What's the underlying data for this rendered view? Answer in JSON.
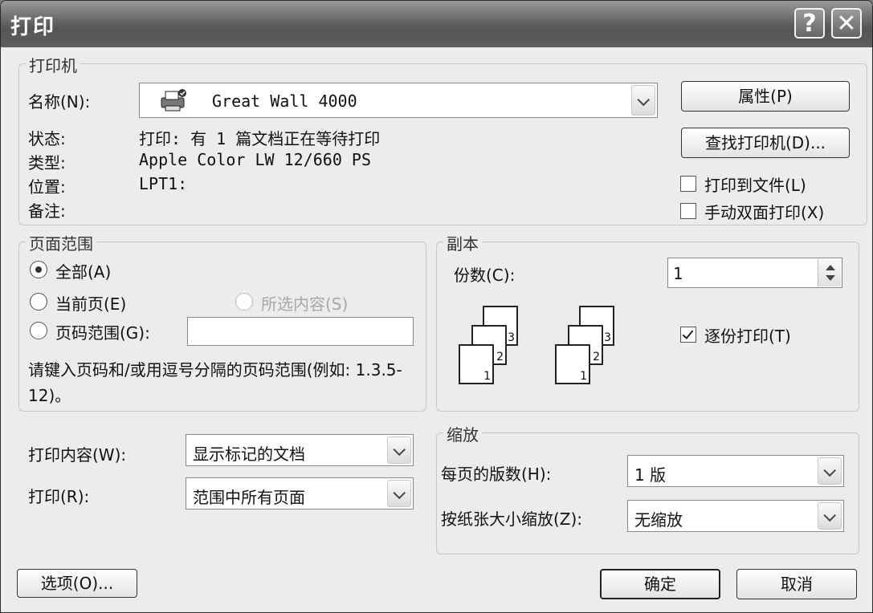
{
  "window": {
    "title": "打印",
    "help_glyph": "?",
    "close_glyph": "✕"
  },
  "printer": {
    "legend": "打印机",
    "name_label": "名称(N):",
    "name_value": "Great Wall 4000",
    "status_label": "状态:",
    "status_value": "打印: 有 1 篇文档正在等待打印",
    "type_label": "类型:",
    "type_value": "Apple Color LW 12/660 PS",
    "location_label": "位置:",
    "location_value": "LPT1:",
    "comment_label": "备注:",
    "properties_button": "属性(P)",
    "find_button": "查找打印机(D)...",
    "print_to_file": {
      "label": "打印到文件(L)",
      "checked": false
    },
    "manual_duplex": {
      "label": "手动双面打印(X)",
      "checked": false
    }
  },
  "page_range": {
    "legend": "页面范围",
    "all": {
      "label": "全部(A)",
      "selected": true
    },
    "current": {
      "label": "当前页(E)",
      "selected": false
    },
    "selection": {
      "label": "所选内容(S)",
      "enabled": false
    },
    "pages": {
      "label": "页码范围(G):",
      "selected": false,
      "value": ""
    },
    "hint": "请键入页码和/或用逗号分隔的页码范围(例如: 1.3.5-12)。"
  },
  "copies": {
    "legend": "副本",
    "count_label": "份数(C):",
    "count_value": "1",
    "collate": {
      "label": "逐份打印(T)",
      "checked": true
    },
    "sheet_numbers": [
      "3",
      "2",
      "1"
    ]
  },
  "print_what": {
    "label": "打印内容(W):",
    "value": "显示标记的文档"
  },
  "print": {
    "label": "打印(R):",
    "value": "范围中所有页面"
  },
  "zoom": {
    "legend": "缩放",
    "pages_per_sheet_label": "每页的版数(H):",
    "pages_per_sheet_value": "1 版",
    "scale_label": "按纸张大小缩放(Z):",
    "scale_value": "无缩放"
  },
  "footer": {
    "options_button": "选项(O)...",
    "ok_button": "确定",
    "cancel_button": "取消"
  },
  "icons": {
    "printer": "printer-icon",
    "dropdown": "chevron-down-icon"
  }
}
